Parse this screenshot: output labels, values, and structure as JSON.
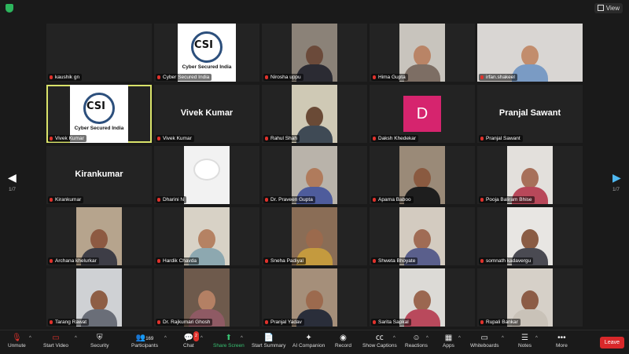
{
  "window": {
    "view_label": "View"
  },
  "nav": {
    "left_page": "1/7",
    "right_page": "1/7"
  },
  "participants": [
    {
      "name": "kaushik gn",
      "kind": "blank"
    },
    {
      "name": "Cyber Secured India",
      "kind": "logo",
      "logo_text": "CSI",
      "caption": "Cyber Secured India"
    },
    {
      "name": "Nirosha uppu",
      "kind": "video",
      "bg": "#8b8278",
      "skin": "#6b4a3a",
      "shirt": "#2b2b33"
    },
    {
      "name": "Hima Gupta",
      "kind": "video",
      "bg": "#c8c4bd",
      "skin": "#b98466",
      "shirt": "#7d6e64"
    },
    {
      "name": "irfan.shakeel",
      "kind": "video",
      "bg": "#d9d6d3",
      "skin": "#c28d6d",
      "shirt": "#7a9bc4"
    },
    {
      "name": "Vivek Kumar",
      "kind": "logo",
      "logo_text": "CSI",
      "caption": "Cyber Secured India",
      "active": true
    },
    {
      "name": "Vivek Kumar",
      "kind": "name",
      "display": "Vivek Kumar"
    },
    {
      "name": "Rahul Shah",
      "kind": "video",
      "bg": "#cfc9b5",
      "skin": "#6a4a36",
      "shirt": "#3f4a55"
    },
    {
      "name": "Daksh Khedekar",
      "kind": "avatar",
      "initial": "D"
    },
    {
      "name": "Pranjal Sawant",
      "kind": "name",
      "display": "Pranjal Sawant"
    },
    {
      "name": "Kirankumar",
      "kind": "name",
      "display": "Kirankumar"
    },
    {
      "name": "Dharini N",
      "kind": "pic",
      "bg": "#f2f2f2"
    },
    {
      "name": "Dr. Praveen Gupta",
      "kind": "video",
      "bg": "#b9b3aa",
      "skin": "#b07b5c",
      "shirt": "#4e5c9c"
    },
    {
      "name": "Aparna Baboo",
      "kind": "video",
      "bg": "#9a8a78",
      "skin": "#8a5a40",
      "shirt": "#1e1e1e"
    },
    {
      "name": "Pooja Baliram Bhise",
      "kind": "video",
      "bg": "#e3e0dc",
      "skin": "#a7705a",
      "shirt": "#b8485a"
    },
    {
      "name": "Archana khelurkar",
      "kind": "video",
      "bg": "#b6a48d",
      "skin": "#8d5a42",
      "shirt": "#3d3d46"
    },
    {
      "name": "Hardik Chavda",
      "kind": "video",
      "bg": "#d8d2c6",
      "skin": "#b58263",
      "shirt": "#8da8b0"
    },
    {
      "name": "Sneha Padiyal",
      "kind": "video",
      "bg": "#8a6d56",
      "skin": "#9b6a4d",
      "shirt": "#c49a3e"
    },
    {
      "name": "Shweta Bhoyate",
      "kind": "video",
      "bg": "#d3cbc0",
      "skin": "#a06c55",
      "shirt": "#5a5f8c"
    },
    {
      "name": "somnath kadavergu",
      "kind": "video",
      "bg": "#e8e6e3",
      "skin": "#8a5c44",
      "shirt": "#4a4a52"
    },
    {
      "name": "Tarang Rawat",
      "kind": "video",
      "bg": "#cfd1d4",
      "skin": "#8e5e45",
      "shirt": "#6a6e78"
    },
    {
      "name": "Dr. Rajkumari Ghosh",
      "kind": "video",
      "bg": "#6e5a4c",
      "skin": "#b48064",
      "shirt": "#8f5a64"
    },
    {
      "name": "Pranjal Yadav",
      "kind": "video",
      "bg": "#a58f7a",
      "skin": "#9c6a4e",
      "shirt": "#2a2e3a"
    },
    {
      "name": "Sarita Sapkal",
      "kind": "video",
      "bg": "#dcdad6",
      "skin": "#9b6750",
      "shirt": "#b9495c"
    },
    {
      "name": "Rupali Bankar",
      "kind": "video",
      "bg": "#d6d0c8",
      "skin": "#8c5c46",
      "shirt": "#c9c2b8"
    }
  ],
  "toolbar": {
    "unmute": "Unmute",
    "start_video": "Start Video",
    "security": "Security",
    "participants": "Participants",
    "participants_count": "169",
    "chat": "Chat",
    "chat_badge": "2",
    "share_screen": "Share Screen",
    "start_summary": "Start Summary",
    "ai_companion": "AI Companion",
    "record": "Record",
    "show_captions": "Show Captions",
    "reactions": "Reactions",
    "apps": "Apps",
    "whiteboards": "Whiteboards",
    "notes": "Notes",
    "more": "More",
    "leave": "Leave"
  },
  "colors": {
    "accent_green": "#38c172",
    "leave_red": "#d8282a",
    "mute_red": "#e0322c",
    "active_border": "#d9e36a",
    "avatar_pink": "#d6246e"
  }
}
